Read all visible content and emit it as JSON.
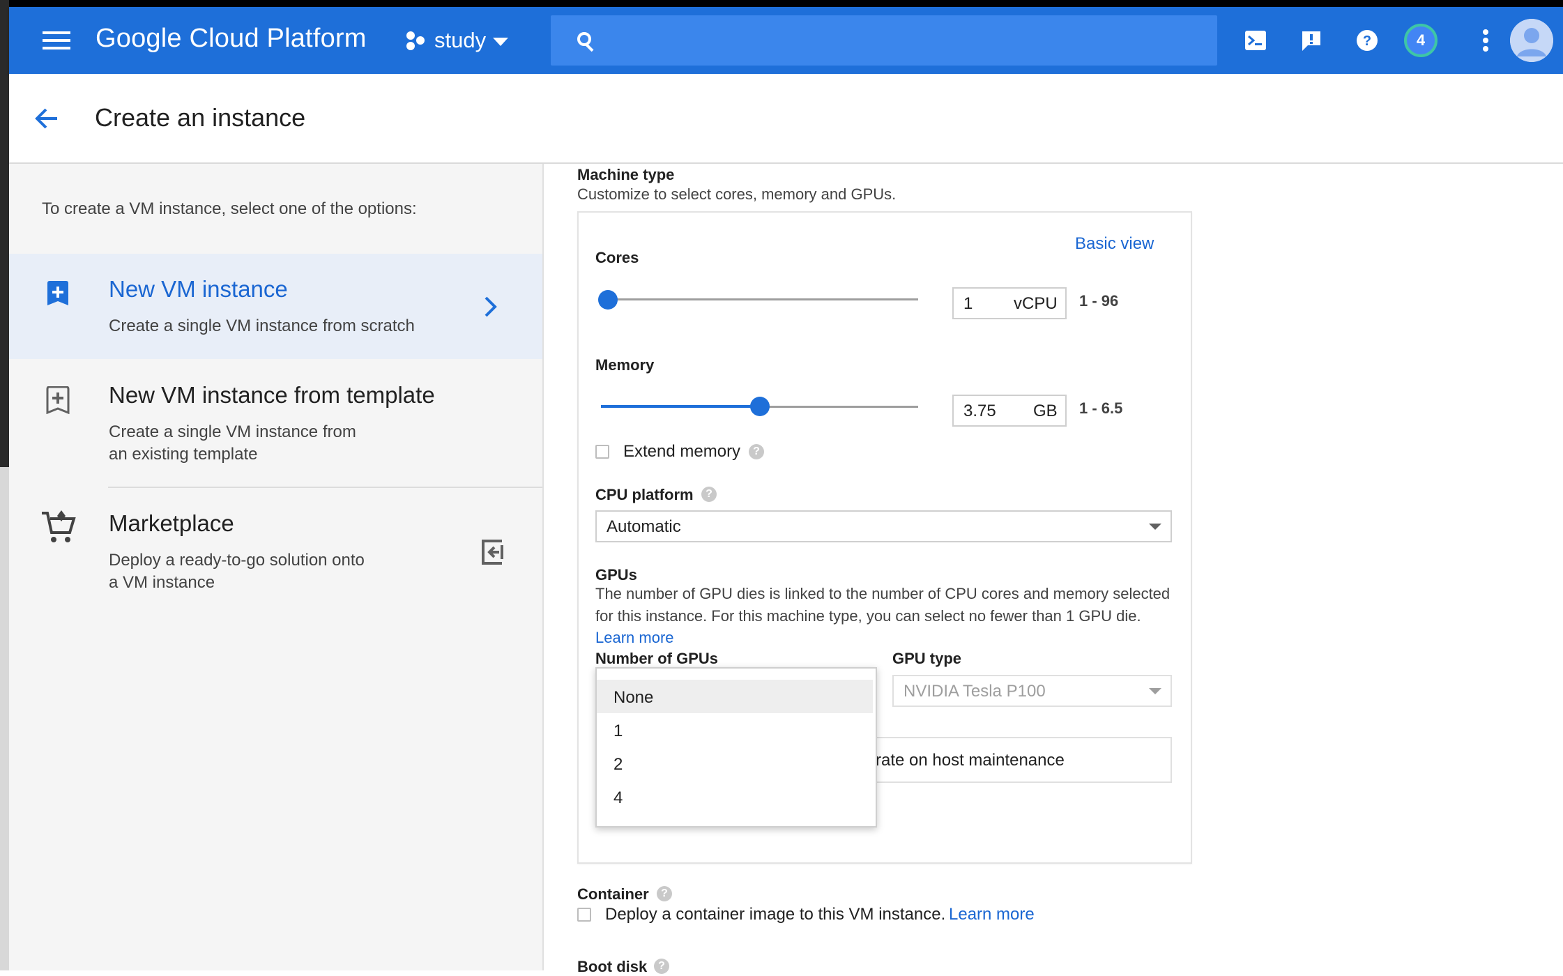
{
  "header": {
    "brand": "Google Cloud Platform",
    "project": "study",
    "notification_count": "4",
    "colors": {
      "bar": "#1e6fd9",
      "search": "#3b86ec"
    }
  },
  "page": {
    "title": "Create an instance"
  },
  "left": {
    "intro": "To create a VM instance, select one of the options:",
    "options": [
      {
        "title": "New VM instance",
        "desc": "Create a single VM instance from scratch",
        "selected": true
      },
      {
        "title": "New VM instance from template",
        "desc_line1": "Create a single VM instance from",
        "desc_line2": "an existing template"
      },
      {
        "title": "Marketplace",
        "desc_line1": "Deploy a ready-to-go solution onto",
        "desc_line2": "a VM instance"
      }
    ]
  },
  "machine_type": {
    "label": "Machine type",
    "subtitle": "Customize to select cores, memory and GPUs.",
    "basic_view_link": "Basic view",
    "cores": {
      "label": "Cores",
      "value": "1",
      "unit": "vCPU",
      "range": "1 - 96",
      "slider_fraction": 0.0
    },
    "memory": {
      "label": "Memory",
      "value": "3.75",
      "unit": "GB",
      "range": "1 - 6.5",
      "slider_fraction": 0.5
    },
    "extend_memory": {
      "label": "Extend memory",
      "checked": false
    },
    "cpu_platform": {
      "label": "CPU platform",
      "selected": "Automatic"
    },
    "gpus": {
      "label": "GPUs",
      "desc_line1": "The number of GPU dies is linked to the number of CPU cores and memory selected",
      "desc_line2": "for this instance. For this machine type, you can select no fewer than 1 GPU die.",
      "learn_more": "Learn more",
      "number_label": "Number of GPUs",
      "type_label": "GPU type",
      "type_value": "NVIDIA Tesla P100",
      "maintenance_text": "rate on host maintenance",
      "menu_options": [
        "None",
        "1",
        "2",
        "4"
      ],
      "menu_selected": "None"
    }
  },
  "container": {
    "label": "Container",
    "checkbox_text": "Deploy a container image to this VM instance.",
    "learn_more": "Learn more",
    "checked": false
  },
  "boot_disk": {
    "label": "Boot disk"
  }
}
